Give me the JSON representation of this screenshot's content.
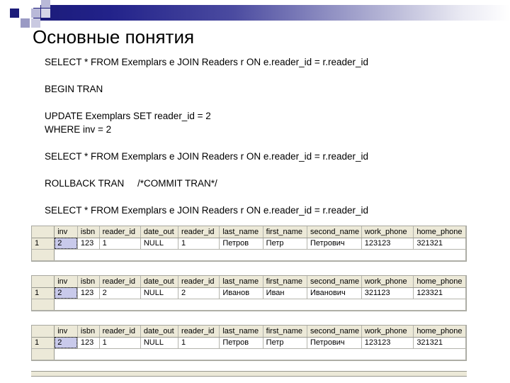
{
  "slide": {
    "title": "Основные понятия"
  },
  "sql": {
    "lines": [
      "SELECT * FROM Exemplars e JOIN Readers r ON e.reader_id = r.reader_id",
      "",
      "BEGIN TRAN",
      "",
      "UPDATE Exemplars SET reader_id = 2",
      "WHERE inv = 2",
      "",
      "SELECT * FROM Exemplars e JOIN Readers r ON e.reader_id = r.reader_id",
      "",
      "ROLLBACK TRAN     /*COMMIT TRAN*/",
      "",
      "SELECT * FROM Exemplars e JOIN Readers r ON e.reader_id = r.reader_id"
    ]
  },
  "colors": {
    "accent_dark": "#1b1b79",
    "header_fill": "#ece9d8",
    "grid_line": "#b4b4ac",
    "selection_fill": "#c9caeb"
  },
  "grids": [
    {
      "name": "result-grid-1",
      "columns": [
        "inv",
        "isbn",
        "reader_id",
        "date_out",
        "reader_id",
        "last_name",
        "first_name",
        "second_name",
        "work_phone",
        "home_phone"
      ],
      "rows": [
        {
          "row_header": "1",
          "cells": [
            "2",
            "123",
            "1",
            "NULL",
            "1",
            "Петров",
            "Петр",
            "Петрович",
            "123123",
            "321321"
          ],
          "selected_index": 0
        }
      ]
    },
    {
      "name": "result-grid-2",
      "columns": [
        "inv",
        "isbn",
        "reader_id",
        "date_out",
        "reader_id",
        "last_name",
        "first_name",
        "second_name",
        "work_phone",
        "home_phone"
      ],
      "rows": [
        {
          "row_header": "1",
          "cells": [
            "2",
            "123",
            "2",
            "NULL",
            "2",
            "Иванов",
            "Иван",
            "Иванович",
            "321123",
            "123321"
          ],
          "selected_index": 0
        }
      ]
    },
    {
      "name": "result-grid-3",
      "columns": [
        "inv",
        "isbn",
        "reader_id",
        "date_out",
        "reader_id",
        "last_name",
        "first_name",
        "second_name",
        "work_phone",
        "home_phone"
      ],
      "rows": [
        {
          "row_header": "1",
          "cells": [
            "2",
            "123",
            "1",
            "NULL",
            "1",
            "Петров",
            "Петр",
            "Петрович",
            "123123",
            "321321"
          ],
          "selected_index": 0
        }
      ]
    }
  ]
}
